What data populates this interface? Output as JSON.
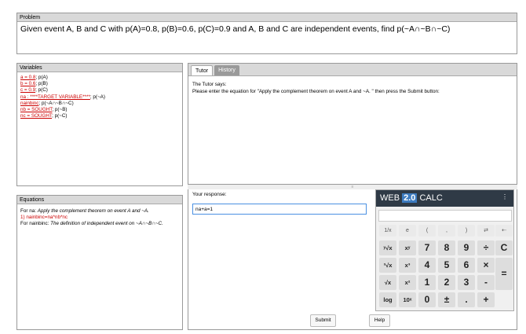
{
  "problem": {
    "header": "Problem",
    "text": "Given event A, B and C with p(A)=0.8, p(B)=0.6, p(C)=0.9 and A, B and C are independent events, find p(~A∩~B∩~C)"
  },
  "variables": {
    "header": "Variables",
    "items": [
      {
        "link": "a = 0.8",
        "desc": "; p(A)"
      },
      {
        "link": "b = 0.6",
        "desc": "; p(B)"
      },
      {
        "link": "c = 0.9",
        "desc": "; p(C)"
      },
      {
        "link": "na : ****TARGET VARIABLE****",
        "desc": "; p(~A)"
      },
      {
        "link": "nainbinc",
        "desc": "; p(~A∩~B∩~C)"
      },
      {
        "link": "nb = SOUGHT",
        "desc": "; p(~B)"
      },
      {
        "link": "nc = SOUGHT",
        "desc": "; p(~C)"
      }
    ]
  },
  "equations": {
    "header": "Equations",
    "line1_prefix": "For na: ",
    "line1_italic": "Apply the complement theorem on event A and ~A.",
    "line2": "1) nainbinc=na*nb*nc",
    "line3_prefix": "For nainbinc: ",
    "line3_italic": "The definition of independent event on ~A∩~B∩~C."
  },
  "tutor": {
    "tabs": [
      "Tutor",
      "History"
    ],
    "says": "The Tutor says:",
    "message": "Please enter the equation for \"Apply the complement theorem on event A and ~A. \" then press the Submit button:"
  },
  "response": {
    "label": "Your response:",
    "value": "na+a=1",
    "submit": "Submit",
    "help": "Help"
  },
  "calculator": {
    "title_web": "WEB",
    "title_ver": "2.0",
    "title_calc": "CALC",
    "menu": "⋮",
    "row1": [
      "1/x",
      "e",
      "(",
      ",",
      ")",
      "⇄",
      "⇠"
    ],
    "row2": [
      "ʸ√x",
      "xʸ",
      "7",
      "8",
      "9",
      "÷",
      "C"
    ],
    "row3": [
      "³√x",
      "x³",
      "4",
      "5",
      "6",
      "×"
    ],
    "row4": [
      "√x",
      "x²",
      "1",
      "2",
      "3",
      "-",
      "="
    ],
    "row5": [
      "log",
      "10ˣ",
      "0",
      "±",
      ".",
      "+"
    ]
  }
}
